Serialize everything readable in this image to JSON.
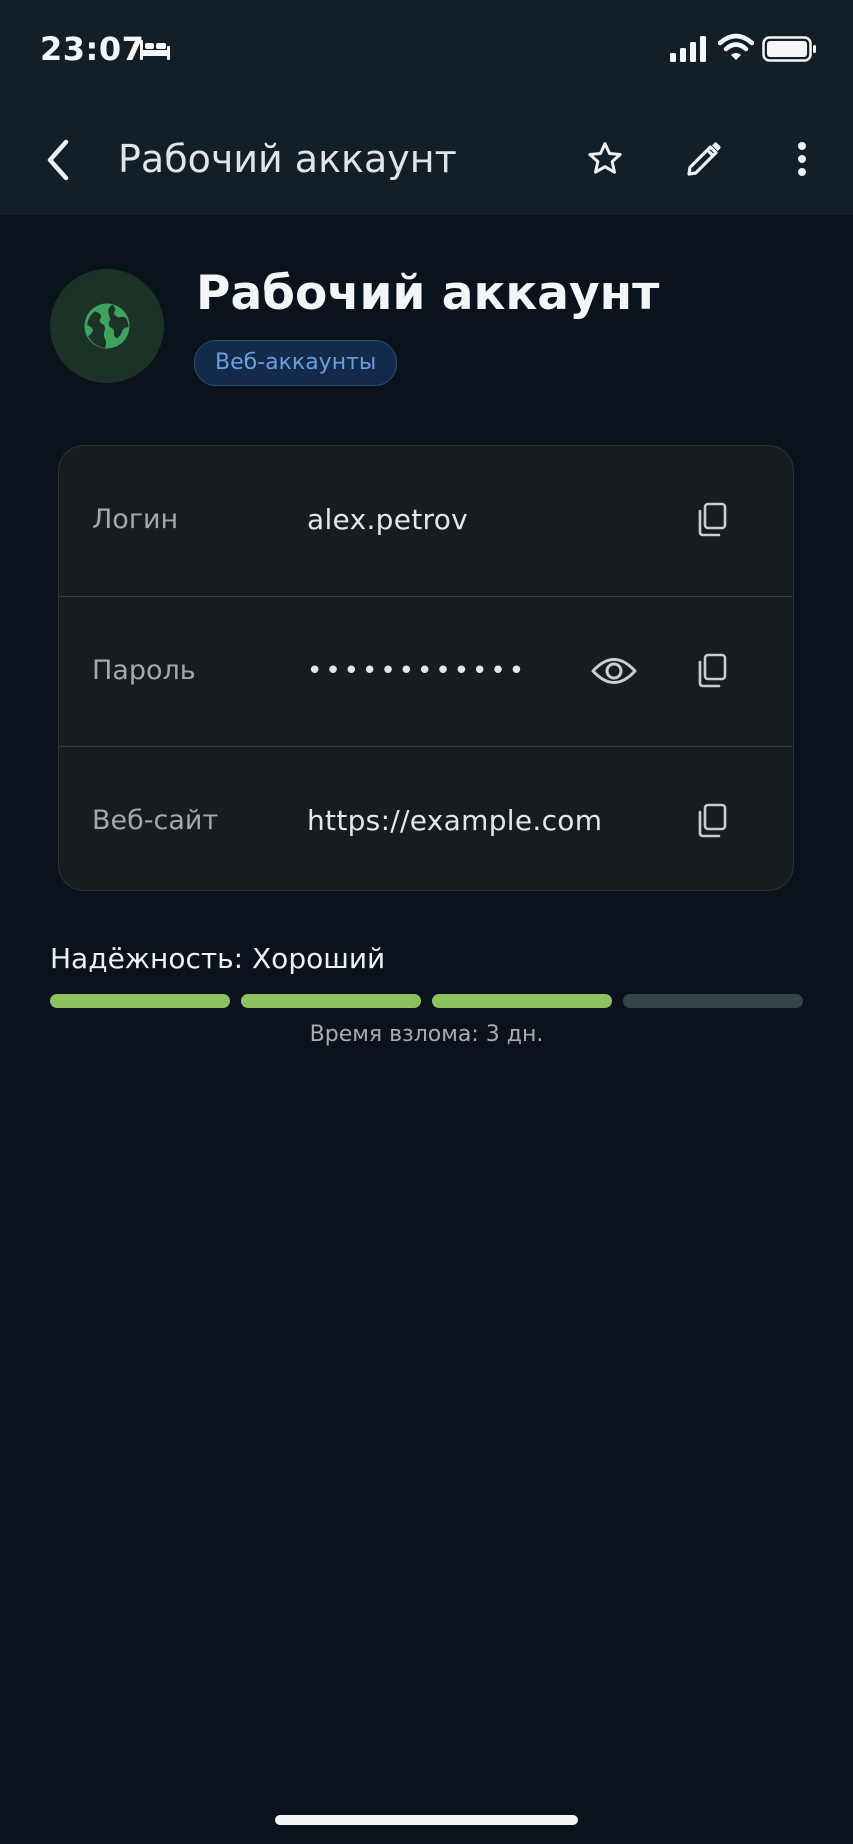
{
  "status_bar": {
    "time": "23:07"
  },
  "app_bar": {
    "title": "Рабочий аккаунт"
  },
  "entry": {
    "title": "Рабочий аккаунт",
    "category": "Веб-аккаунты"
  },
  "fields": [
    {
      "label": "Логин",
      "value": "alex.petrov"
    },
    {
      "label": "Пароль",
      "value": "••••••••••••"
    },
    {
      "label": "Веб-сайт",
      "value": "https://example.com"
    }
  ],
  "strength": {
    "label": "Надёжность: Хороший",
    "level": 3,
    "max": 4,
    "crack_time": "Время взлома: 3 дн."
  },
  "colors": {
    "strength_on": "#8cc35e",
    "strength_off": "#384347",
    "chip_text": "#6d9ee0",
    "globe": "#3fa25f"
  }
}
